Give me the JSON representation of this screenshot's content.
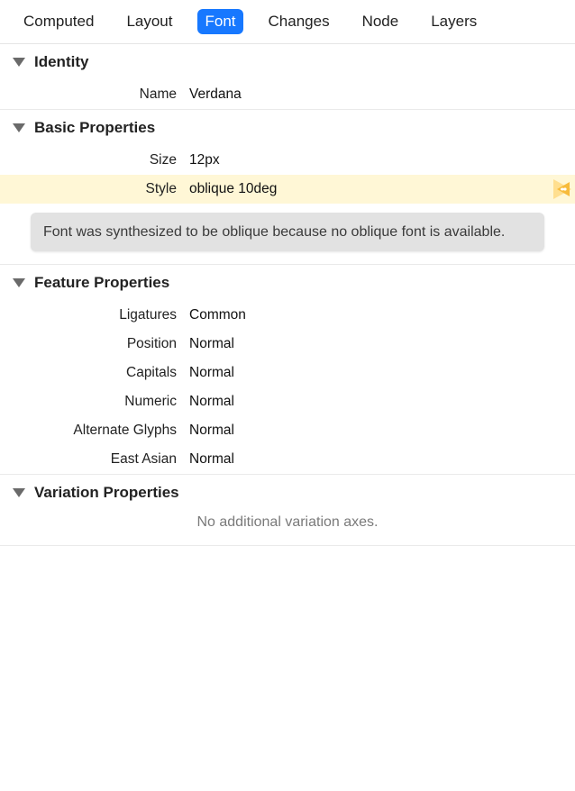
{
  "tabs": [
    {
      "label": "Computed",
      "active": false
    },
    {
      "label": "Layout",
      "active": false
    },
    {
      "label": "Font",
      "active": true
    },
    {
      "label": "Changes",
      "active": false
    },
    {
      "label": "Node",
      "active": false
    },
    {
      "label": "Layers",
      "active": false
    }
  ],
  "sections": {
    "identity": {
      "title": "Identity",
      "rows": [
        {
          "label": "Name",
          "value": "Verdana"
        }
      ]
    },
    "basic": {
      "title": "Basic Properties",
      "rows": [
        {
          "label": "Size",
          "value": "12px"
        },
        {
          "label": "Style",
          "value": "oblique 10deg",
          "highlight": true,
          "warning": true
        }
      ],
      "tooltip": "Font was synthesized to be oblique because no oblique font is available."
    },
    "features": {
      "title": "Feature Properties",
      "rows": [
        {
          "label": "Ligatures",
          "value": "Common"
        },
        {
          "label": "Position",
          "value": "Normal"
        },
        {
          "label": "Capitals",
          "value": "Normal"
        },
        {
          "label": "Numeric",
          "value": "Normal"
        },
        {
          "label": "Alternate Glyphs",
          "value": "Normal"
        },
        {
          "label": "East Asian",
          "value": "Normal"
        }
      ]
    },
    "variation": {
      "title": "Variation Properties",
      "empty": "No additional variation axes."
    }
  }
}
